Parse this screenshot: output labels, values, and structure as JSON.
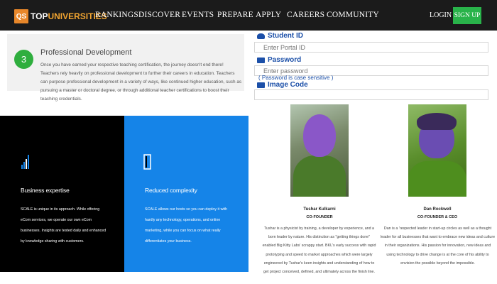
{
  "nav": {
    "logo_mark": "QS",
    "logo_top": "TOP",
    "logo_uni": "UNIVERSITIES",
    "links": [
      "RANKINGS",
      "DISCOVER",
      "EVENTS",
      "PREPARE",
      "APPLY",
      "CAREERS",
      "COMMUNITY"
    ],
    "login": "LOGIN",
    "signup": "SIGN UP"
  },
  "pd": {
    "number": "3",
    "title": "Professional Development",
    "text": "Once you have earned your respective teaching certification, the journey doesn't end there! Teachers rely heavily on professional development to further their careers in education. Teachers can purpose professional development in a variety of ways, like continued higher education, such as pursuing a master or doctoral degree, or through additional teacher certifications to boost their teaching credentials."
  },
  "form": {
    "student_label": "Student ID",
    "student_placeholder": "Enter Portal ID",
    "password_label": "Password",
    "password_placeholder": "Enter password",
    "case_note": "( Password is case sensitive )",
    "image_label": "Image Code"
  },
  "features": [
    {
      "title": "Business expertise",
      "text": "SCALE is unique in its approach. While offering eCom services, we operate our own eCom businesses. Insights are tested daily and enhanced by knowledge sharing with customers.",
      "icon": "bar-chart-icon"
    },
    {
      "title": "Reduced complexity",
      "text": "SCALE allows our hosts so you can deploy it with hardly any technology, operations, and online marketing, while you can focus on what really differentiates your business.",
      "icon": "document-icon"
    }
  ],
  "team": [
    {
      "name": "Tushar Kulkarni",
      "role": "CO-FOUNDER",
      "bio": "Tushar is a physicist by training, a developer by experience, and a born leader by nature. His distinction as \"getting things done\" enabled Big Kitty Labs' scrappy start. BKL's early success with rapid prototyping and speed to market approaches which were largely engineered by Tushar's keen insights and understanding of how to get project conceived, defined, and ultimately across the finish line."
    },
    {
      "name": "Dan Rockwell",
      "role": "CO-FOUNDER & CEO",
      "bio": "Dan is a 'respected leader in start-up circles as well as a thought leader for all businesses that want to embrace new ideas and culture in their organizations. His passion for innovation, new ideas and using technology to drive change is at the core of his ability to envision the possible beyond the impossible."
    }
  ],
  "colors": {
    "nav_bg": "#1b1b1b",
    "brand_orange": "#e8872a",
    "signup_green": "#29b34a",
    "step_green": "#2fae3e",
    "form_blue": "#1b4fa8",
    "feature_blue": "#1584e8"
  }
}
